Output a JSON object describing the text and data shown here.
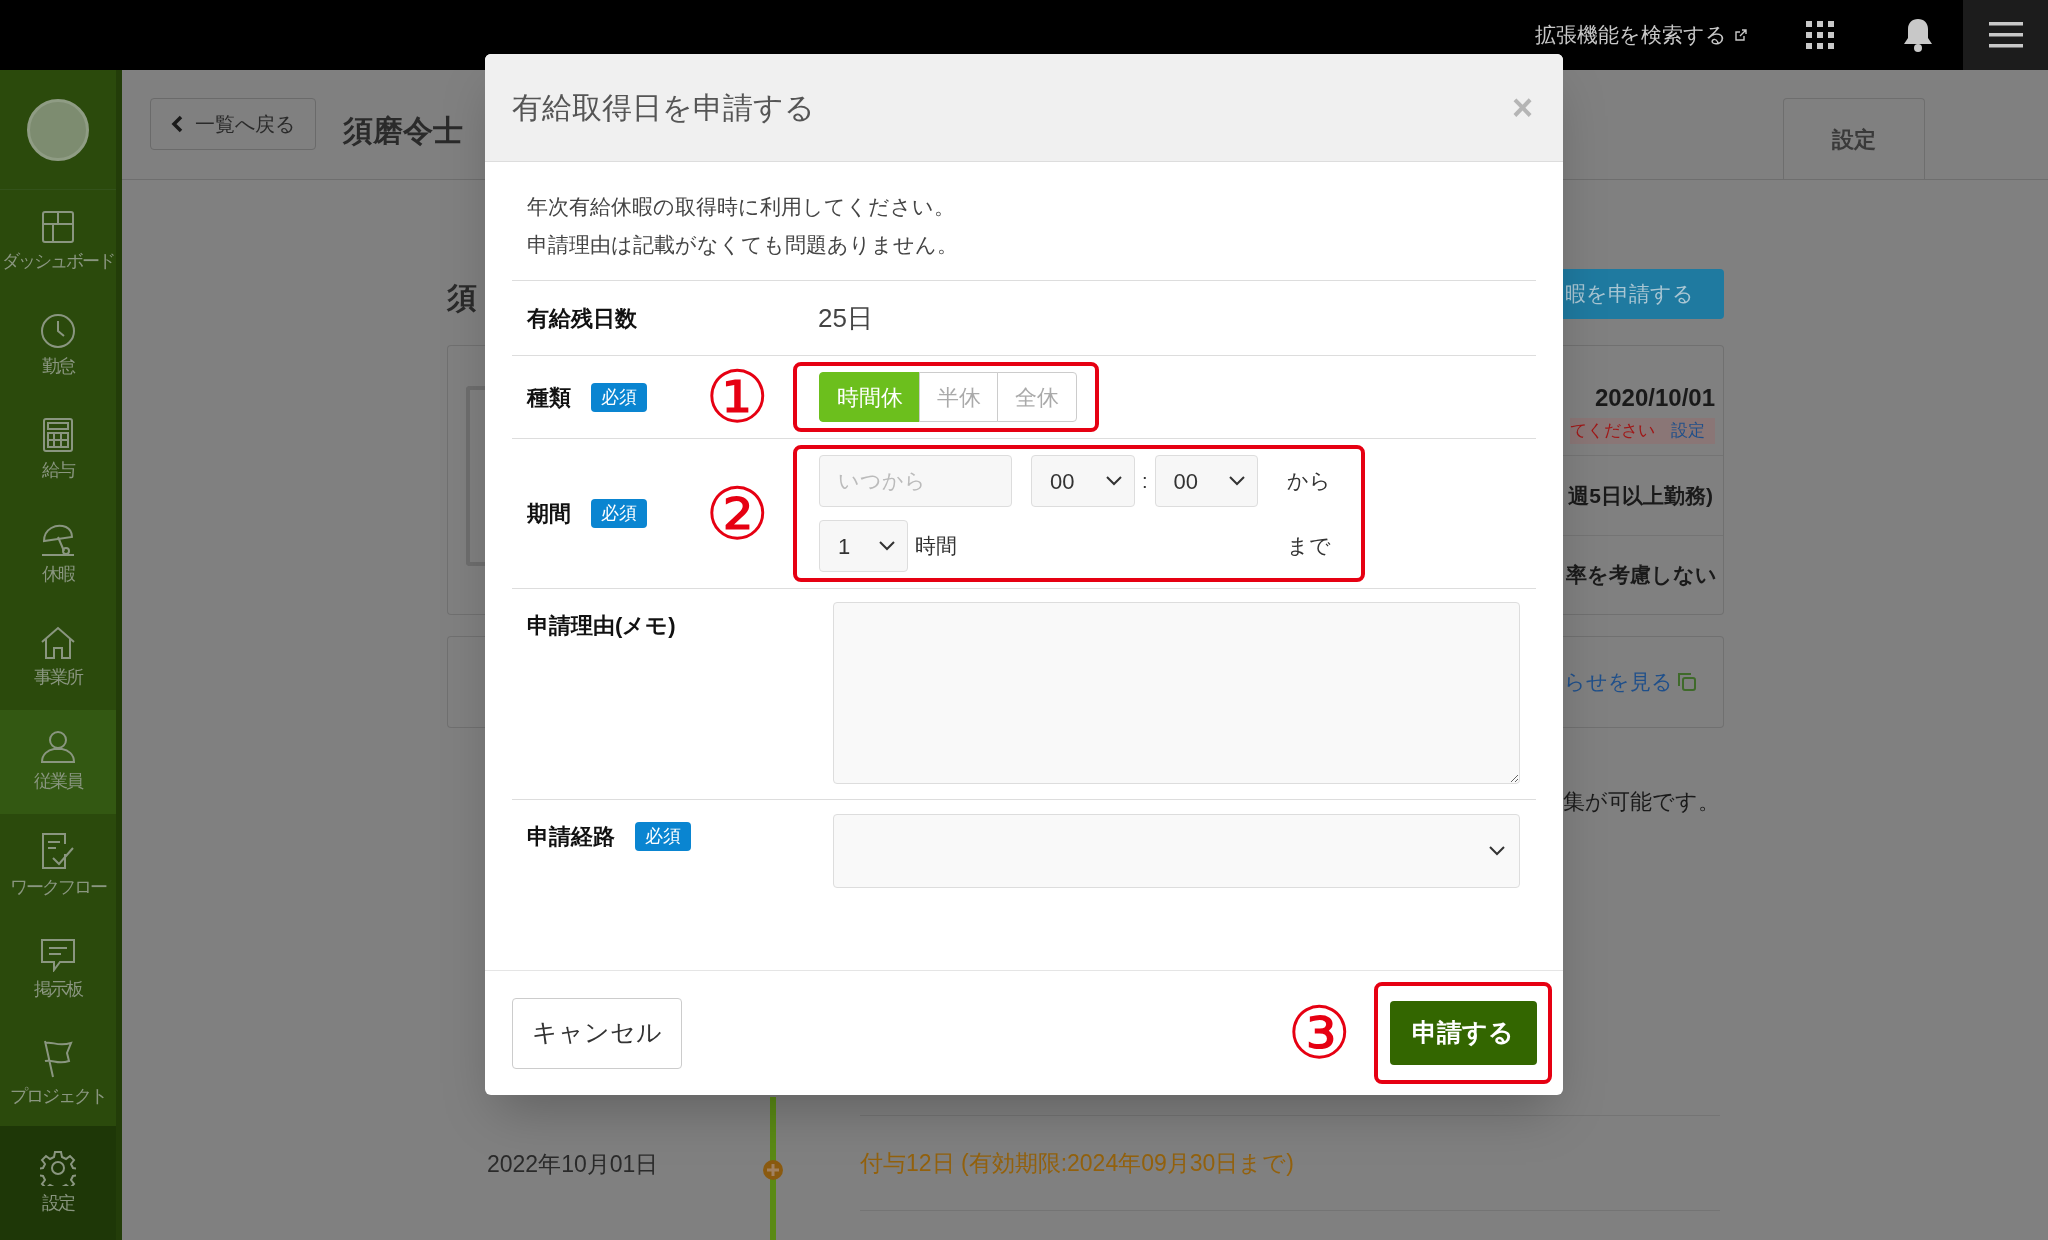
{
  "top_bar": {
    "extension_search": "拡張機能を検索する"
  },
  "sidebar": {
    "items": [
      {
        "label": "ダッシュボード",
        "selected": false
      },
      {
        "label": "勤怠",
        "selected": false
      },
      {
        "label": "給与",
        "selected": false
      },
      {
        "label": "休暇",
        "selected": false
      },
      {
        "label": "事業所",
        "selected": false
      },
      {
        "label": "従業員",
        "selected": true
      },
      {
        "label": "ワークフロー",
        "selected": false
      },
      {
        "label": "掲示板",
        "selected": false
      },
      {
        "label": "プロジェクト",
        "selected": false
      },
      {
        "label": "設定",
        "selected": false
      }
    ]
  },
  "page_header": {
    "back_button": "一覧へ戻る",
    "employee_name": "須磨令士",
    "tab": "設定"
  },
  "background": {
    "heading_fragment": "須",
    "apply_button": "暇を申請する",
    "date": "2020/10/01",
    "notice": "てください",
    "notice_link": "設定",
    "work_pattern": "週5日以上勤務)",
    "rule": "率を考慮しない",
    "news_link": "らせを見る",
    "note": "集が可能です。",
    "timeline": [
      {
        "date": "2022年10月01日",
        "event": "付与12日 (有効期限:2024年09月30日まで)"
      }
    ]
  },
  "modal": {
    "title": "有給取得日を申請する",
    "close": "×",
    "description": [
      "年次有給休暇の取得時に利用してください。",
      "申請理由は記載がなくても問題ありません。"
    ],
    "balance": {
      "label": "有給残日数",
      "value": "25日"
    },
    "type": {
      "label": "種類",
      "badge": "必須",
      "annotation": "①",
      "options": [
        {
          "label": "時間休",
          "selected": true
        },
        {
          "label": "半休",
          "selected": false
        },
        {
          "label": "全休",
          "selected": false
        }
      ]
    },
    "period": {
      "label": "期間",
      "badge": "必須",
      "annotation": "②",
      "start": {
        "placeholder": "いつから"
      },
      "hour": "00",
      "separator": ":",
      "minute": "00",
      "from": "から",
      "duration": "1",
      "duration_unit": "時間",
      "until": "まで"
    },
    "memo": {
      "label": "申請理由(メモ)"
    },
    "route": {
      "label": "申請経路",
      "badge": "必須"
    },
    "cancel": "キャンセル",
    "submit": "申請する",
    "submit_annotation": "③"
  }
}
